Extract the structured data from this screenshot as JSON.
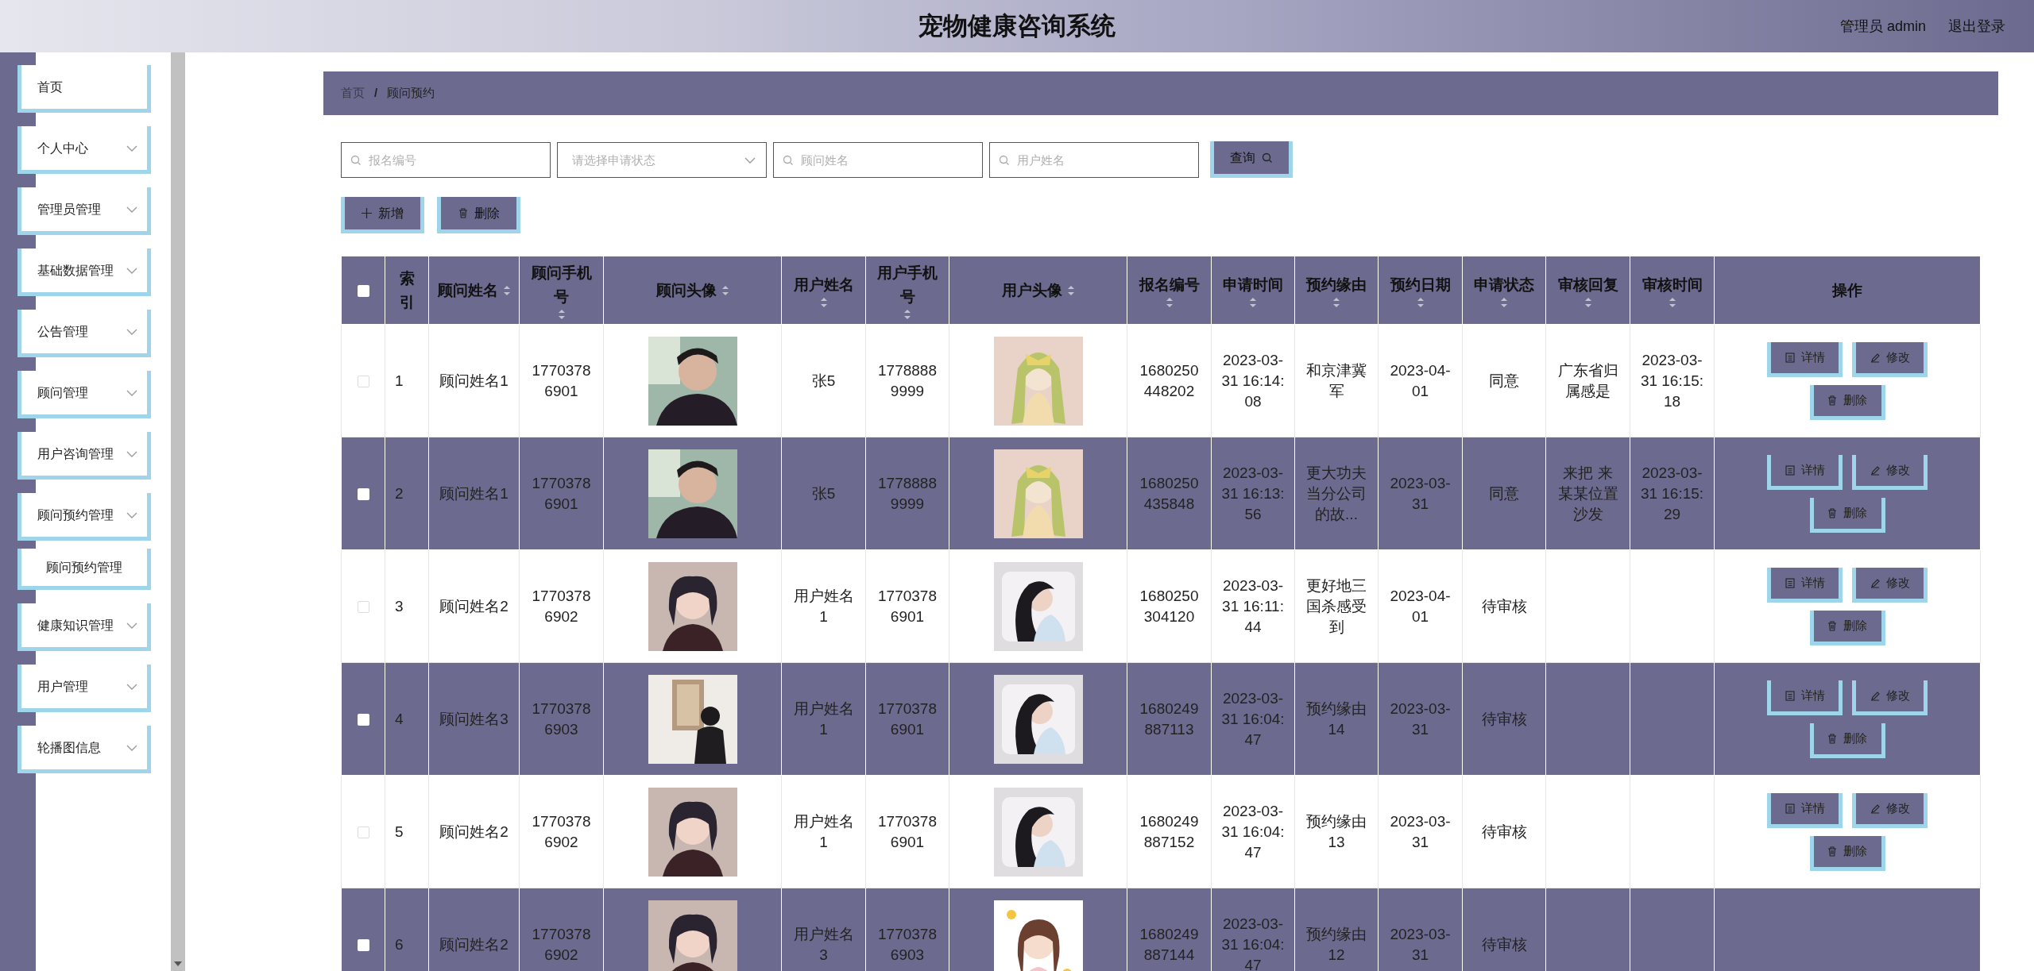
{
  "header": {
    "title": "宠物健康咨询系统",
    "user": "管理员 admin",
    "logout": "退出登录"
  },
  "sidebar": {
    "items": [
      {
        "label": "首页",
        "has_arrow": false
      },
      {
        "label": "个人中心",
        "has_arrow": true
      },
      {
        "label": "管理员管理",
        "has_arrow": true
      },
      {
        "label": "基础数据管理",
        "has_arrow": true
      },
      {
        "label": "公告管理",
        "has_arrow": true
      },
      {
        "label": "顾问管理",
        "has_arrow": true
      },
      {
        "label": "用户咨询管理",
        "has_arrow": true
      },
      {
        "label": "顾问预约管理",
        "has_arrow": true,
        "children": [
          {
            "label": "顾问预约管理"
          }
        ]
      },
      {
        "label": "健康知识管理",
        "has_arrow": true
      },
      {
        "label": "用户管理",
        "has_arrow": true
      },
      {
        "label": "轮播图信息",
        "has_arrow": true
      }
    ]
  },
  "breadcrumb": {
    "items": [
      "首页",
      "顾问预约"
    ],
    "separator": "/"
  },
  "filters": [
    {
      "kind": "search",
      "placeholder": "报名编号"
    },
    {
      "kind": "select",
      "placeholder": "请选择申请状态"
    },
    {
      "kind": "search",
      "placeholder": "顾问姓名"
    },
    {
      "kind": "search",
      "placeholder": "用户姓名"
    }
  ],
  "query_button": "查询",
  "actions": [
    {
      "kind": "add",
      "label": "新增"
    },
    {
      "kind": "delete",
      "label": "删除"
    }
  ],
  "table": {
    "select_all_checked": false,
    "columns": [
      {
        "label": "索引",
        "kind": "text",
        "sortable": false
      },
      {
        "label": "顾问姓名",
        "kind": "text",
        "sortable": true
      },
      {
        "label": "顾问手机号",
        "kind": "text",
        "sortable": true
      },
      {
        "label": "顾问头像",
        "sortable": true
      },
      {
        "label": "用户姓名",
        "kind": "text",
        "sortable": true
      },
      {
        "label": "用户手机号",
        "kind": "text",
        "sortable": true
      },
      {
        "label": "用户头像",
        "sortable": true
      },
      {
        "label": "报名编号",
        "kind": "text",
        "sortable": true
      },
      {
        "label": "申请时间",
        "kind": "text",
        "sortable": true
      },
      {
        "label": "预约缘由",
        "kind": "text",
        "sortable": true
      },
      {
        "label": "预约日期",
        "kind": "text",
        "sortable": true
      },
      {
        "label": "申请状态",
        "kind": "text",
        "sortable": true
      },
      {
        "label": "审核回复",
        "kind": "text",
        "sortable": true
      },
      {
        "label": "审核时间",
        "kind": "text",
        "sortable": true
      },
      {
        "label": "操作",
        "kind": "ops",
        "sortable": false
      }
    ],
    "rows": [
      {
        "checked": false,
        "cells": [
          "1",
          "顾问姓名1",
          "17703786901",
          {
            "kind": "picture"
          },
          "张5",
          "17788889999",
          {
            "kind": "picture"
          },
          "1680250448202",
          "2023-03-31 16:14:08",
          "和京津冀军",
          "2023-04-01",
          "同意",
          "广东省归属感是",
          "2023-03-31 16:15:18"
        ],
        "ops": [
          "详情",
          "修改",
          "删除"
        ]
      },
      {
        "checked": false,
        "cells": [
          "2",
          "顾问姓名1",
          "17703786901",
          {
            "kind": "picture"
          },
          "张5",
          "17788889999",
          {
            "kind": "picture"
          },
          "1680250435848",
          "2023-03-31 16:13:56",
          "更大功夫当分公司的故...",
          "2023-03-31",
          "同意",
          "来把 来某某位置沙发",
          "2023-03-31 16:15:29"
        ],
        "ops": [
          "详情",
          "修改",
          "删除"
        ]
      },
      {
        "checked": false,
        "cells": [
          "3",
          "顾问姓名2",
          "17703786902",
          {
            "kind": "picture"
          },
          "用户姓名1",
          "17703786901",
          {
            "kind": "picture"
          },
          "1680250304120",
          "2023-03-31 16:11:44",
          "更好地三国杀感受到",
          "2023-04-01",
          "待审核",
          null,
          null
        ],
        "ops": [
          "详情",
          "修改",
          "删除"
        ]
      },
      {
        "checked": false,
        "cells": [
          "4",
          "顾问姓名3",
          "17703786903",
          {
            "kind": "picture"
          },
          "用户姓名1",
          "17703786901",
          {
            "kind": "picture"
          },
          "1680249887113",
          "2023-03-31 16:04:47",
          "预约缘由14",
          "2023-03-31",
          "待审核",
          null,
          null
        ],
        "ops": [
          "详情",
          "修改",
          "删除"
        ]
      },
      {
        "checked": false,
        "cells": [
          "5",
          "顾问姓名2",
          "17703786902",
          {
            "kind": "picture"
          },
          "用户姓名1",
          "17703786901",
          {
            "kind": "picture"
          },
          "1680249887152",
          "2023-03-31 16:04:47",
          "预约缘由13",
          "2023-03-31",
          "待审核",
          null,
          null
        ],
        "ops": [
          "详情",
          "修改",
          "删除"
        ]
      },
      {
        "checked": false,
        "cells": [
          "6",
          "顾问姓名2",
          "17703786902",
          {
            "kind": "picture"
          },
          "用户姓名3",
          "17703786903",
          {
            "kind": "picture"
          },
          "1680249887144",
          "2023-03-31 16:04:47",
          "预约缘由12",
          "2023-03-31",
          "待审核",
          null,
          null
        ]
      }
    ]
  }
}
